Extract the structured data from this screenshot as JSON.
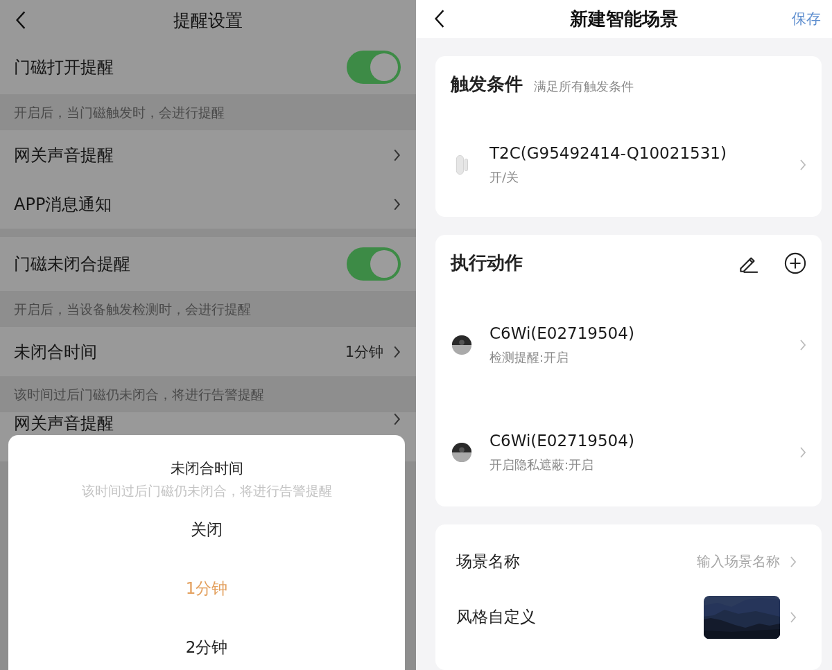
{
  "left": {
    "title": "提醒设置",
    "sections": [
      {
        "rows": [
          {
            "kind": "toggle",
            "label": "门磁打开提醒",
            "on": true
          },
          {
            "kind": "hint",
            "text": "开启后，当门磁触发时，会进行提醒"
          },
          {
            "kind": "link",
            "label": "网关声音提醒"
          },
          {
            "kind": "link",
            "label": "APP消息通知"
          }
        ]
      },
      {
        "rows": [
          {
            "kind": "toggle",
            "label": "门磁未闭合提醒",
            "on": true
          },
          {
            "kind": "hint",
            "text": "开启后，当设备触发检测时，会进行提醒"
          },
          {
            "kind": "link",
            "label": "未闭合时间",
            "value": "1分钟"
          },
          {
            "kind": "hint",
            "text": "该时间过后门磁仍未闭合，将进行告警提醒"
          },
          {
            "kind": "link",
            "label": "网关声音提醒"
          }
        ]
      }
    ],
    "sheet": {
      "title": "未闭合时间",
      "subtitle": "该时间过后门磁仍未闭合，将进行告警提醒",
      "options": [
        {
          "label": "关闭",
          "selected": false
        },
        {
          "label": "1分钟",
          "selected": true
        },
        {
          "label": "2分钟",
          "selected": false
        }
      ]
    }
  },
  "right": {
    "title": "新建智能场景",
    "save": "保存",
    "trigger": {
      "title": "触发条件",
      "subtitle": "满足所有触发条件",
      "devices": [
        {
          "kind": "sensor",
          "name": "T2C(G95492414-Q10021531)",
          "detail": "开/关"
        }
      ]
    },
    "action": {
      "title": "执行动作",
      "devices": [
        {
          "kind": "camera",
          "name": "C6Wi(E02719504)",
          "detail": "检测提醒:开启"
        },
        {
          "kind": "camera",
          "name": "C6Wi(E02719504)",
          "detail": "开启隐私遮蔽:开启"
        }
      ]
    },
    "settings": [
      {
        "kind": "input",
        "label": "场景名称",
        "placeholder": "输入场景名称"
      },
      {
        "kind": "picture",
        "label": "风格自定义"
      }
    ]
  }
}
